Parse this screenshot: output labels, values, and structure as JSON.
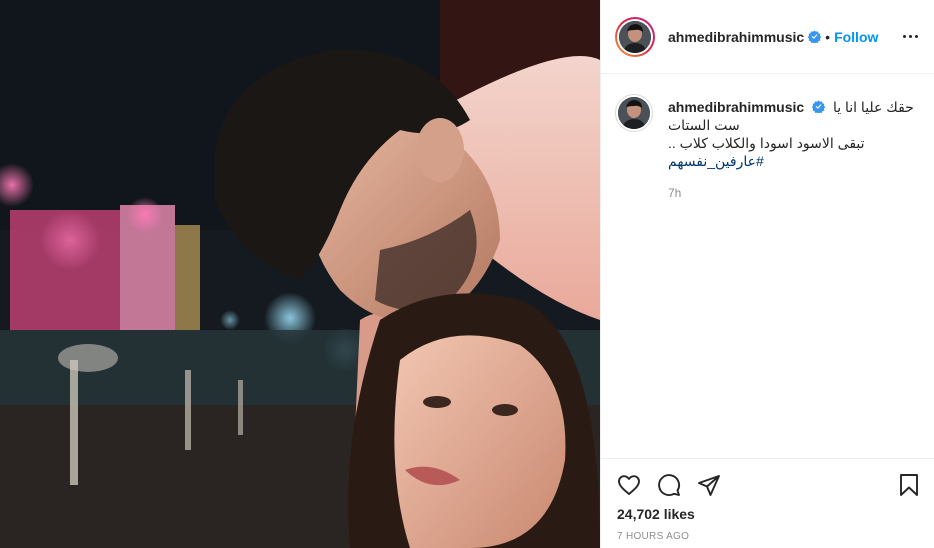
{
  "post": {
    "username": "ahmedibrahimmusic",
    "verified": true,
    "follow_label": "Follow",
    "separator": "•",
    "caption": {
      "line1": "حقك عليا انا يا",
      "line2": "ست الستات",
      "line3": "تبقى الاسود اسودا والكلاب كلاب ..",
      "hashtag": "#عارفين_نفسهم"
    },
    "caption_time": "7h",
    "likes": "24,702 likes",
    "posted_ago": "7 HOURS AGO"
  },
  "icons": {
    "more": "more-options-icon",
    "like": "heart-icon",
    "comment": "comment-icon",
    "share": "share-icon",
    "save": "bookmark-icon",
    "verified": "verified-badge-icon"
  },
  "colors": {
    "follow": "#0095f6",
    "verified": "#3897f0",
    "hashtag": "#00376b",
    "muted": "#8e8e8e"
  }
}
